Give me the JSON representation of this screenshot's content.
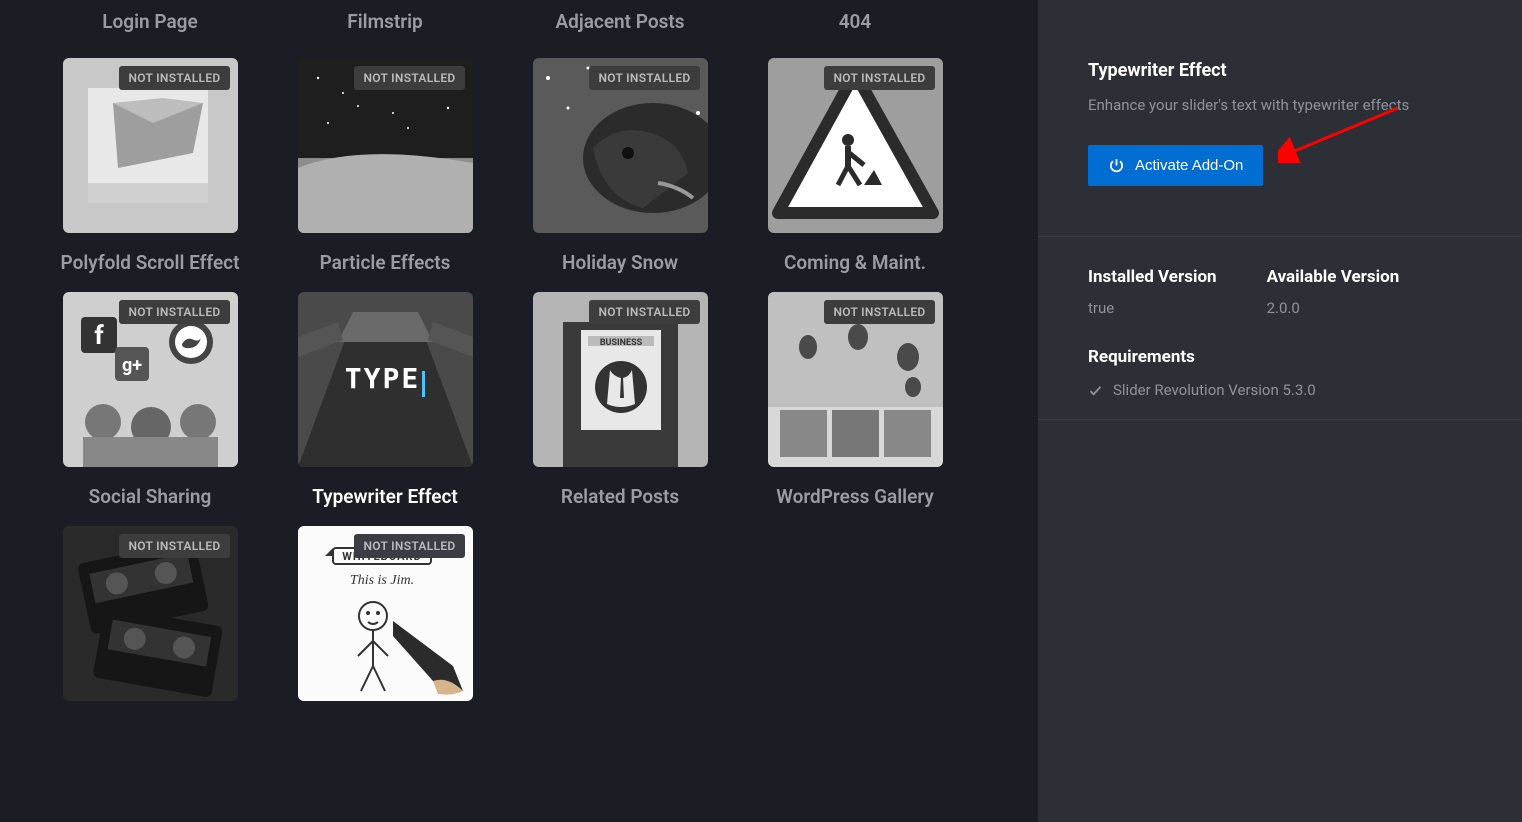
{
  "row0Titles": [
    "Login Page",
    "Filmstrip",
    "Adjacent Posts",
    "404"
  ],
  "addons": [
    {
      "label": "Polyfold Scroll Effect",
      "badge": "NOT INSTALLED",
      "selected": false,
      "art": "polyfold"
    },
    {
      "label": "Particle Effects",
      "badge": "NOT INSTALLED",
      "selected": false,
      "art": "particles"
    },
    {
      "label": "Holiday Snow",
      "badge": "NOT INSTALLED",
      "selected": false,
      "art": "snow"
    },
    {
      "label": "Coming & Maint.",
      "badge": "NOT INSTALLED",
      "selected": false,
      "art": "maint"
    },
    {
      "label": "Social Sharing",
      "badge": "NOT INSTALLED",
      "selected": false,
      "art": "social"
    },
    {
      "label": "Typewriter Effect",
      "badge": null,
      "selected": true,
      "art": "type"
    },
    {
      "label": "Related Posts",
      "badge": "NOT INSTALLED",
      "selected": false,
      "art": "related"
    },
    {
      "label": "WordPress Gallery",
      "badge": "NOT INSTALLED",
      "selected": false,
      "art": "gallery"
    },
    {
      "label": "",
      "badge": "NOT INSTALLED",
      "selected": false,
      "art": "cassette"
    },
    {
      "label": "",
      "badge": "NOT INSTALLED",
      "selected": false,
      "art": "whiteboard"
    }
  ],
  "sidebar": {
    "title": "Typewriter Effect",
    "desc": "Enhance your slider's text with typewriter effects",
    "activateLabel": "Activate Add-On",
    "installedLabel": "Installed Version",
    "installedValue": "true",
    "availableLabel": "Available Version",
    "availableValue": "2.0.0",
    "reqLabel": "Requirements",
    "req1": "Slider Revolution Version 5.3.0"
  },
  "thumbWords": {
    "typeText": "TYPE",
    "whiteboardLabel": "WHITEBOARD",
    "whiteboardCaption": "This is Jim.",
    "businessLabel": "BUSINESS"
  }
}
